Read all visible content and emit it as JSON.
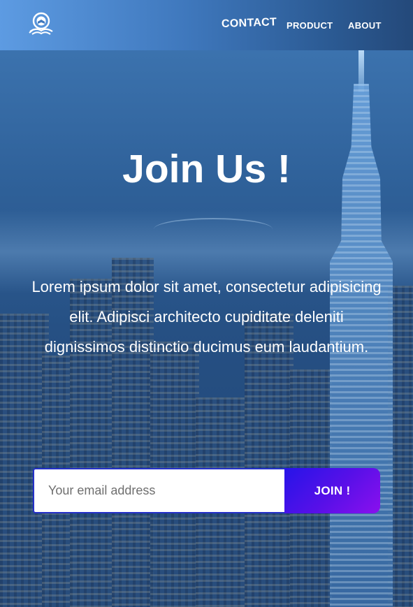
{
  "nav": {
    "logo_icon": "book-globe-logo",
    "items": [
      {
        "label": "CONTACT"
      },
      {
        "label": "PRODUCT"
      },
      {
        "label": "ABOUT"
      }
    ]
  },
  "hero": {
    "title": "Join Us !",
    "description": "Lorem ipsum dolor sit amet, consectetur adipisicing elit. Adipisci architecto cupiditate deleniti dignissimos distinctio ducimus eum laudantium."
  },
  "signup": {
    "email_placeholder": "Your email address",
    "email_value": "",
    "button_label": "JOIN !"
  },
  "colors": {
    "header_gradient_start": "#5d9be2",
    "header_gradient_end": "#24497a",
    "button_gradient_start": "#2614e8",
    "button_gradient_end": "#8a10ee",
    "input_border": "#2530c9"
  }
}
